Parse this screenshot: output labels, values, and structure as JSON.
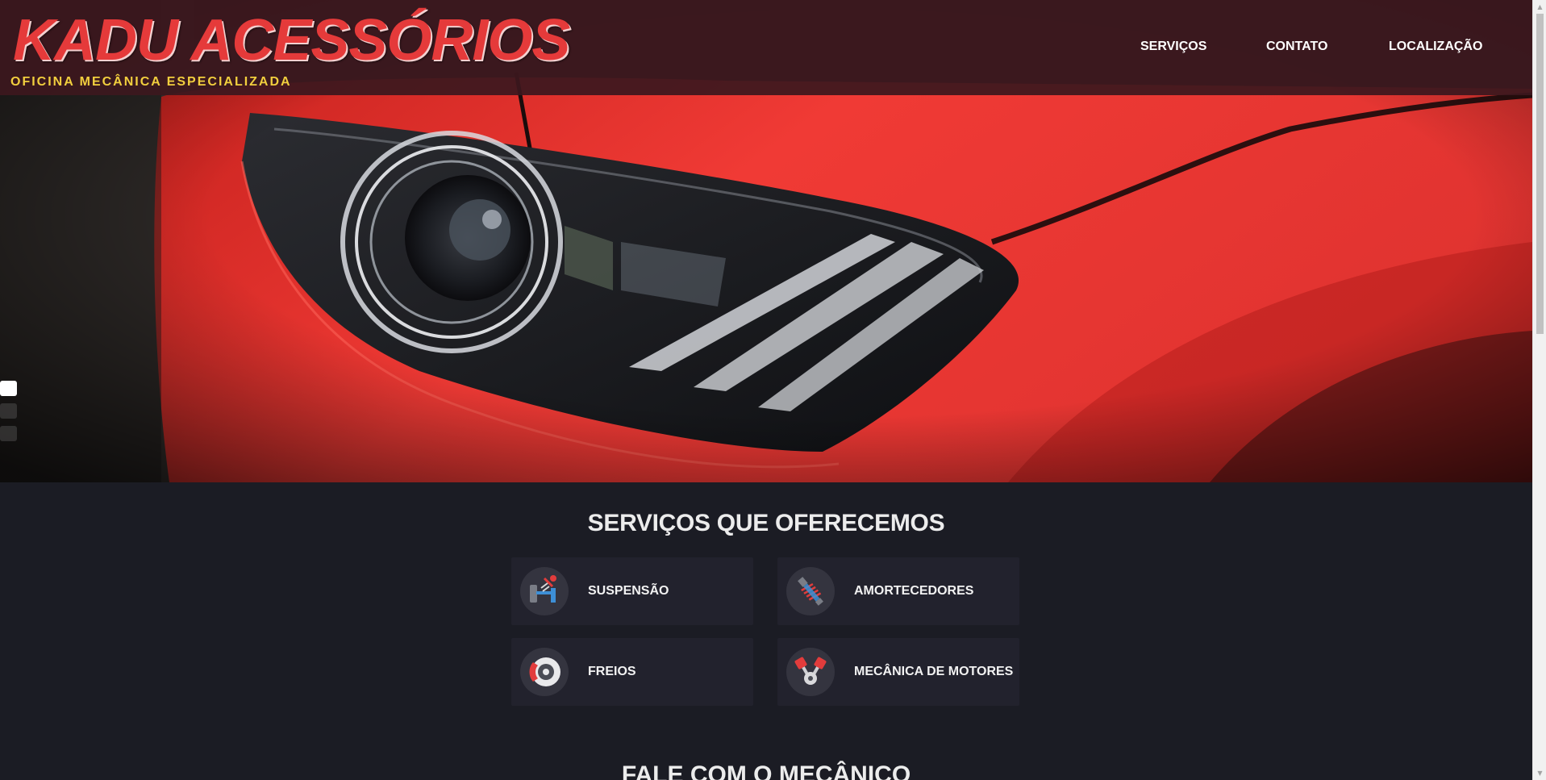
{
  "header": {
    "brand_title": "KADU ACESSÓRIOS",
    "brand_subtitle": "OFICINA MECÂNICA ESPECIALIZADA",
    "nav": [
      "SERVIÇOS",
      "CONTATO",
      "LOCALIZAÇÃO"
    ]
  },
  "hero": {
    "slide_count": 3,
    "active_slide": 1
  },
  "services": {
    "title": "SERVIÇOS QUE OFERECEMOS",
    "items": [
      {
        "label": "SUSPENSÃO",
        "icon": "suspension-icon"
      },
      {
        "label": "AMORTECEDORES",
        "icon": "shock-absorber-icon"
      },
      {
        "label": "FREIOS",
        "icon": "brake-disc-icon"
      },
      {
        "label": "MECÂNICA DE MOTORES",
        "icon": "engine-piston-icon"
      }
    ]
  },
  "contact": {
    "title": "FALE COM O MECÂNICO"
  },
  "colors": {
    "brand_red": "#e53a3a",
    "brand_yellow": "#f2cf3e",
    "page_bg": "#1b1c24",
    "card_bg": "#22222d"
  }
}
